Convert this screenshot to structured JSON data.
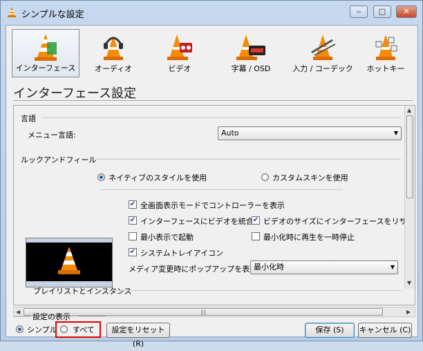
{
  "window": {
    "title": "シンプルな設定",
    "minimize": "‒",
    "maximize": "□",
    "close": "✕"
  },
  "categories": [
    {
      "label": "インターフェース",
      "icon": "cone-interface-icon",
      "selected": true
    },
    {
      "label": "オーディオ",
      "icon": "cone-headphones-icon",
      "selected": false
    },
    {
      "label": "ビデオ",
      "icon": "cone-video-icon",
      "selected": false
    },
    {
      "label": "字幕 / OSD",
      "icon": "cone-subtitles-icon",
      "selected": false
    },
    {
      "label": "入力 / コーデック",
      "icon": "cone-codec-icon",
      "selected": false
    },
    {
      "label": "ホットキー",
      "icon": "cone-hotkeys-icon",
      "selected": false
    }
  ],
  "heading": "インターフェース設定",
  "language": {
    "group": "言語",
    "label": "メニュー言語:",
    "value": "Auto"
  },
  "look": {
    "group": "ルックアンドフィール",
    "native_style": "ネイティブのスタイルを使用",
    "custom_skin": "カスタムスキンを使用",
    "fullscreen_controller": "全画面表示モードでコントローラーを表示",
    "integrate_video": "インターフェースにビデオを統合",
    "resize_to_video": "ビデオのサイズにインターフェースをリサイズ",
    "start_minimal": "最小表示で起動",
    "pause_minimized": "最小化時に再生を一時停止",
    "systray": "システムトレイアイコン",
    "popup_label": "メディア変更時にポップアップを表示:",
    "popup_value": "最小化時"
  },
  "playlist_group": "プレイリストとインスタンス",
  "bottom": {
    "show_settings": "設定の表示",
    "simple": "シンプル",
    "all": "すべて",
    "reset": "設定をリセット (R)",
    "save": "保存 (S)",
    "cancel": "キャンセル (C)"
  },
  "colors": {
    "accent": "#1c5aa6",
    "highlight_box": "#e00000"
  }
}
